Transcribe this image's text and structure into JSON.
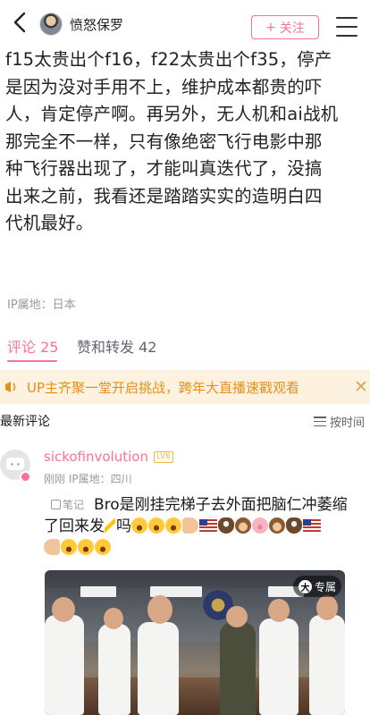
{
  "header": {
    "username": "愤怒保罗",
    "follow_label": "关注",
    "follow_plus": "+"
  },
  "article": {
    "lines": [
      "f15太贵出个f16，f22太贵出个f35，停产",
      "是因为没对手用不上，维护成本都贵的吓",
      "人，肯定停产啊。再另外，无人机和ai战机",
      "那完全不一样，只有像绝密飞行电影中那",
      "种飞行器出现了，才能叫真迭代了，没搞",
      "出来之前，我看还是踏踏实实的造明白四",
      "代机最好。"
    ]
  },
  "ip_location": "IP属地：日本",
  "tabs": {
    "comments": "评论 25",
    "likes_reposts": "赞和转发 42"
  },
  "banner": {
    "text": "UP主齐聚一堂开启挑战，跨年大直播速戳观看",
    "close": "✕"
  },
  "comments_section": {
    "title": "最新评论",
    "sort_label": "按时间"
  },
  "comment": {
    "username": "sickofinvolution",
    "level": "LV6",
    "meta": "刚刚 IP属地：四川",
    "note_tag": "笔记",
    "line1_text": "Bro是刚挂完梯子去外面把脑仁冲萎缩",
    "line2_text": "了回来发",
    "line2_tail": "吗",
    "emojis_line2": [
      "bolt-emoji",
      "laugh-emoji",
      "laugh-emoji",
      "laugh-emoji",
      "hand-emoji",
      "us-flag-emoji",
      "eagle-emoji",
      "monkey-emoji",
      "pig-emoji",
      "monkey-emoji",
      "eagle-emoji",
      "us-flag-emoji"
    ],
    "emojis_line3": [
      "point-emoji",
      "laugh-emoji",
      "laugh-emoji",
      "laugh-emoji"
    ],
    "video_badge": "专属",
    "video_badge_icon": "大"
  }
}
